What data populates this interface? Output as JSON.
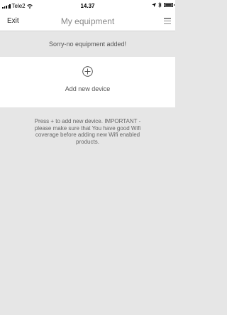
{
  "status_bar": {
    "carrier": "Tele2",
    "time": "14.37"
  },
  "nav": {
    "back_label": "Exit",
    "title": "My equipment"
  },
  "notice": "Sorry-no equipment added!",
  "add_device": {
    "label": "Add new device"
  },
  "help_text": "Press + to add new device. IMPORTANT - please make sure that You have good Wifi coverage before adding new Wifi enabled products."
}
